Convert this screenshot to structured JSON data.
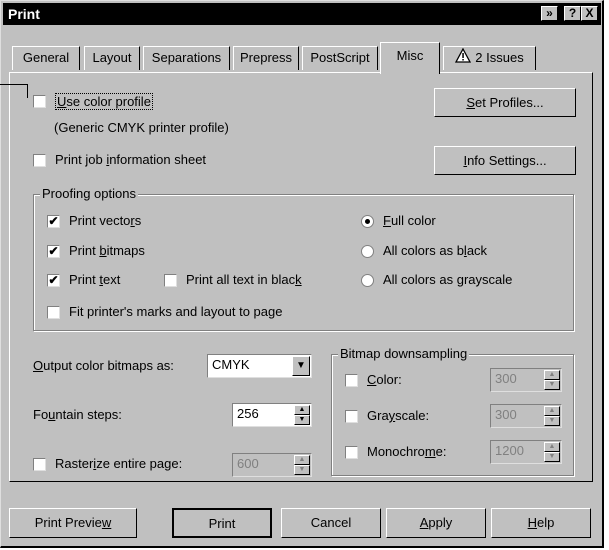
{
  "window": {
    "title": "Print"
  },
  "titlebar_buttons": {
    "restore": "»",
    "help": "?",
    "close": "X"
  },
  "tabs": [
    "General",
    "Layout",
    "Separations",
    "Prepress",
    "PostScript",
    "Misc",
    "2 Issues"
  ],
  "active_tab": "Misc",
  "misc": {
    "use_color_profile": {
      "label": "Use color profile",
      "checked": false
    },
    "profile_desc": "(Generic CMYK printer profile)",
    "set_profiles_button": "Set Profiles...",
    "print_job_sheet": {
      "label": "Print job information sheet",
      "checked": false
    },
    "info_settings_button": "Info Settings...",
    "proofing": {
      "title": "Proofing options",
      "print_vectors": {
        "label": "Print vectors",
        "checked": true
      },
      "print_bitmaps": {
        "label": "Print bitmaps",
        "checked": true
      },
      "print_text": {
        "label": "Print text",
        "checked": true
      },
      "print_all_text_black": {
        "label": "Print all text in black",
        "checked": false
      },
      "fit_marks": {
        "label": "Fit printer's marks and layout to page",
        "checked": false
      },
      "full_color": {
        "label": "Full color",
        "selected": true
      },
      "all_black": {
        "label": "All colors as black",
        "selected": false
      },
      "all_grayscale": {
        "label": "All colors as grayscale",
        "selected": false
      }
    },
    "output_bitmaps": {
      "label": "Output color bitmaps as:",
      "value": "CMYK"
    },
    "fountain_steps": {
      "label": "Fountain steps:",
      "value": "256"
    },
    "rasterize": {
      "label": "Rasterize entire page:",
      "value": "600",
      "checked": false
    },
    "downsampling": {
      "title": "Bitmap downsampling",
      "color": {
        "label": "Color:",
        "value": "300",
        "checked": false
      },
      "grayscale": {
        "label": "Grayscale:",
        "value": "300",
        "checked": false
      },
      "monochrome": {
        "label": "Monochrome:",
        "value": "1200",
        "checked": false
      }
    }
  },
  "footer_buttons": {
    "print_preview": "Print Preview",
    "print": "Print",
    "cancel": "Cancel",
    "apply": "Apply",
    "help": "Help"
  },
  "colors": {
    "titlebar": "#000000",
    "face": "#c0c0c0",
    "disabled_text": "#808080"
  }
}
